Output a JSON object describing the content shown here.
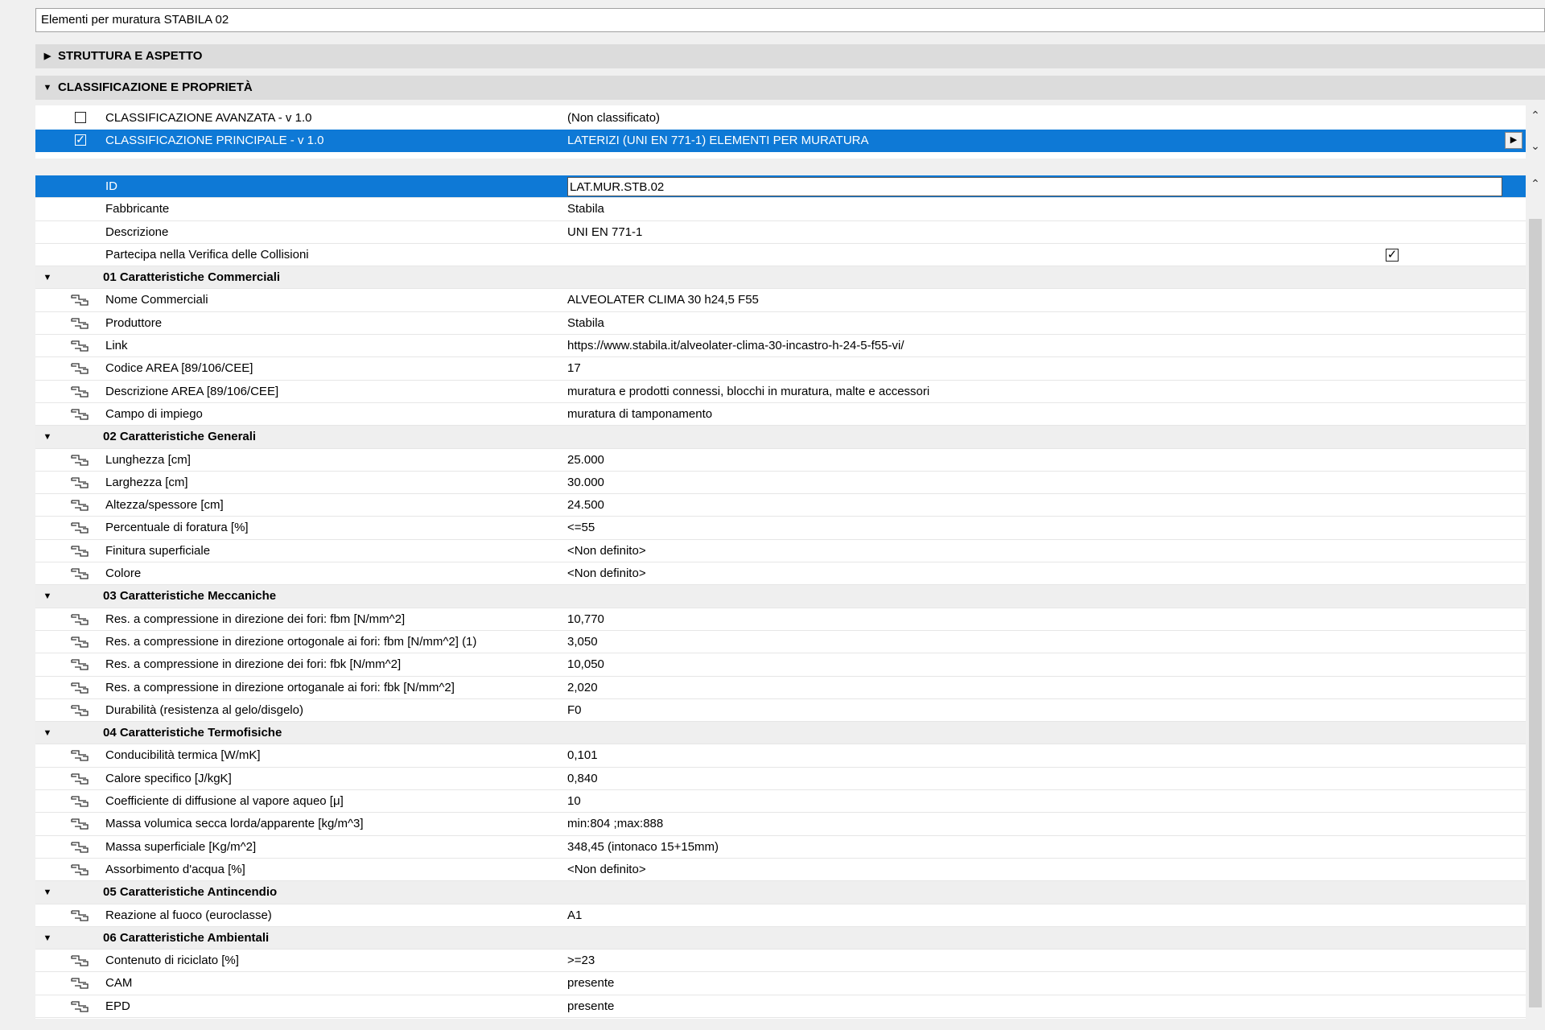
{
  "window": {
    "title_field": "Elementi per muratura STABILA 02"
  },
  "sections": {
    "structure": {
      "label": "STRUTTURA E ASPETTO",
      "expanded": false
    },
    "classification": {
      "label": "CLASSIFICAZIONE E PROPRIETÀ",
      "expanded": true
    }
  },
  "classifications": [
    {
      "name": "CLASSIFICAZIONE AVANZATA - v 1.0",
      "value": "(Non classificato)",
      "checked": false,
      "selected": false
    },
    {
      "name": "CLASSIFICAZIONE PRINCIPALE - v 1.0",
      "value": "LATERIZI (UNI EN 771-1) ELEMENTI PER MURATURA",
      "checked": true,
      "selected": true
    }
  ],
  "general_props": {
    "id_label": "ID",
    "id_value": "LAT.MUR.STB.02",
    "manufacturer_label": "Fabbricante",
    "manufacturer_value": "Stabila",
    "description_label": "Descrizione",
    "description_value": "UNI EN 771-1",
    "collision_label": "Partecipa nella Verifica delle Collisioni",
    "collision_checked": true
  },
  "groups": [
    {
      "title": "01 Caratteristiche Commerciali",
      "props": [
        {
          "name": "Nome Commerciali",
          "value": "ALVEOLATER CLIMA 30 h24,5 F55"
        },
        {
          "name": "Produttore",
          "value": "Stabila"
        },
        {
          "name": "Link",
          "value": "https://www.stabila.it/alveolater-clima-30-incastro-h-24-5-f55-vi/"
        },
        {
          "name": "Codice AREA [89/106/CEE]",
          "value": "17"
        },
        {
          "name": "Descrizione AREA [89/106/CEE]",
          "value": "muratura e prodotti connessi, blocchi in muratura, malte e accessori"
        },
        {
          "name": "Campo di impiego",
          "value": "muratura di tamponamento"
        }
      ]
    },
    {
      "title": "02 Caratteristiche Generali",
      "props": [
        {
          "name": "Lunghezza [cm]",
          "value": "25.000"
        },
        {
          "name": "Larghezza [cm]",
          "value": "30.000"
        },
        {
          "name": "Altezza/spessore [cm]",
          "value": "24.500"
        },
        {
          "name": "Percentuale di foratura [%]",
          "value": "<=55"
        },
        {
          "name": "Finitura superficiale",
          "value": "<Non definito>"
        },
        {
          "name": "Colore",
          "value": "<Non definito>"
        }
      ]
    },
    {
      "title": "03 Caratteristiche Meccaniche",
      "props": [
        {
          "name": "Res. a compressione in direzione dei fori: fbm [N/mm^2]",
          "value": "10,770"
        },
        {
          "name": "Res. a compressione in direzione ortogonale ai fori: fbm [N/mm^2] (1)",
          "value": "3,050"
        },
        {
          "name": "Res. a compressione in direzione dei fori: fbk [N/mm^2]",
          "value": "10,050"
        },
        {
          "name": "Res. a compressione in direzione ortoganale ai fori: fbk [N/mm^2]",
          "value": "2,020"
        },
        {
          "name": "Durabilità (resistenza al gelo/disgelo)",
          "value": "F0"
        }
      ]
    },
    {
      "title": "04 Caratteristiche Termofisiche",
      "props": [
        {
          "name": "Conducibilità termica [W/mK]",
          "value": "0,101"
        },
        {
          "name": "Calore specifico [J/kgK]",
          "value": "0,840"
        },
        {
          "name": "Coefficiente di diffusione al vapore aqueo [μ]",
          "value": "10"
        },
        {
          "name": "Massa volumica secca lorda/apparente [kg/m^3]",
          "value": "min:804 ;max:888"
        },
        {
          "name": "Massa superficiale [Kg/m^2]",
          "value": "348,45 (intonaco 15+15mm)"
        },
        {
          "name": "Assorbimento d'acqua [%]",
          "value": "<Non definito>"
        }
      ]
    },
    {
      "title": "05 Caratteristiche Antincendio",
      "props": [
        {
          "name": "Reazione al fuoco (euroclasse)",
          "value": "A1"
        }
      ]
    },
    {
      "title": "06 Caratteristiche Ambientali",
      "props": [
        {
          "name": "Contenuto di riciclato [%]",
          "value": ">=23"
        },
        {
          "name": "CAM",
          "value": "presente"
        },
        {
          "name": "EPD",
          "value": "presente"
        }
      ]
    }
  ],
  "icons": {
    "expanded": "triangle-down-icon",
    "collapsed": "triangle-right-icon",
    "link": "linked-property-icon"
  },
  "colors": {
    "selection": "#0e79d6",
    "group_bg": "#efefef",
    "section_bg": "#dcdcdc"
  }
}
